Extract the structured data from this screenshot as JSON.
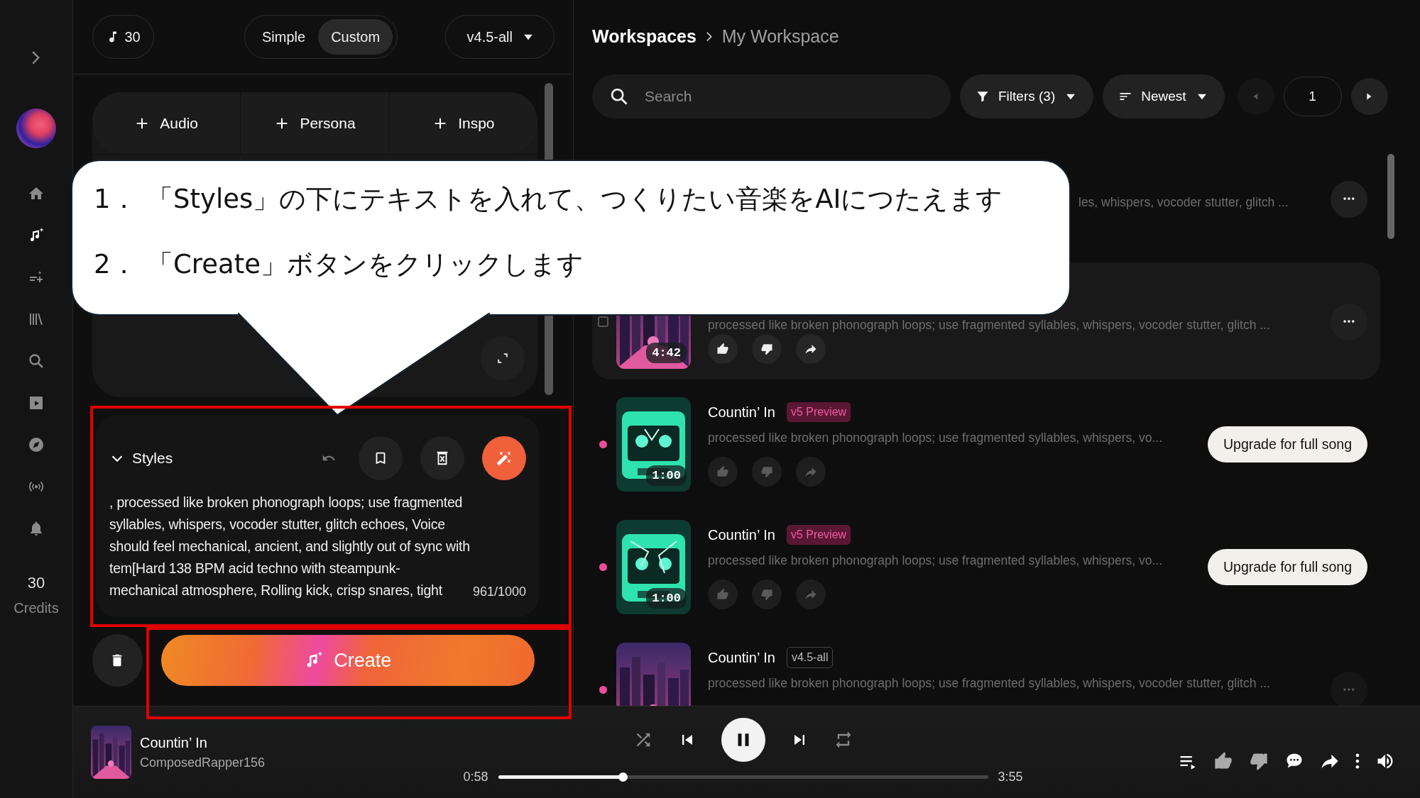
{
  "sidebar": {
    "nav": [
      {
        "kind": "home",
        "selected": false
      },
      {
        "kind": "create",
        "selected": true
      },
      {
        "kind": "playlist_add",
        "selected": false
      },
      {
        "kind": "library",
        "selected": false
      },
      {
        "kind": "search",
        "selected": false
      },
      {
        "kind": "video",
        "selected": false
      },
      {
        "kind": "explore",
        "selected": false
      },
      {
        "kind": "radio",
        "selected": false
      },
      {
        "kind": "notifications",
        "selected": false
      }
    ],
    "credits": {
      "count": "30",
      "label": "Credits"
    }
  },
  "create_panel": {
    "credits_pill": "30",
    "modes": [
      {
        "label": "Simple",
        "selected": false
      },
      {
        "label": "Custom",
        "selected": true
      }
    ],
    "model": "v4.5-all",
    "add_buttons": [
      "Audio",
      "Persona",
      "Inspo"
    ],
    "styles": {
      "title": "Styles",
      "expanded": true,
      "lines": [
        ", processed like broken phonograph loops; use fragmented",
        "syllables, whispers, vocoder stutter, glitch echoes, Voice",
        "should feel mechanical, ancient, and slightly out of sync with",
        "tem[Hard 138 BPM acid techno with steampunk-",
        "mechanical atmosphere, Rolling kick, crisp snares, tight"
      ],
      "counter": "961/1000",
      "highlighted": true
    },
    "create_button": {
      "label": "Create",
      "highlighted": true
    }
  },
  "workspace": {
    "breadcrumb": [
      {
        "label": "Workspaces",
        "current": false
      },
      {
        "label": "My Workspace",
        "current": true
      }
    ],
    "search": {
      "placeholder": "Search"
    },
    "filters": "Filters (3)",
    "sort": "Newest",
    "page": "1",
    "songs": [
      {
        "kind": "covered",
        "description": "les, whispers, vocoder stutter, glitch ..."
      },
      {
        "kind": "full",
        "duration": "4:42",
        "description": "processed like broken phonograph loops; use fragmented syllables, whispers, vocoder stutter, glitch ...",
        "new": false,
        "hovered": true
      },
      {
        "kind": "full",
        "title": "Countin’ In",
        "badge": {
          "label": "v5 Preview",
          "kind": "preview"
        },
        "duration": "1:00",
        "description": "processed like broken phonograph loops; use fragmented syllables, whispers, vo...",
        "new": true,
        "hovered": false,
        "action": "Upgrade for full song"
      },
      {
        "kind": "full",
        "title": "Countin’ In",
        "badge": {
          "label": "v5 Preview",
          "kind": "preview"
        },
        "duration": "1:00",
        "description": "processed like broken phonograph loops; use fragmented syllables, whispers, vo...",
        "new": true,
        "hovered": false,
        "action": "Upgrade for full song"
      },
      {
        "kind": "full",
        "title": "Countin’ In",
        "badge": {
          "label": "v4.5-all",
          "kind": "model"
        },
        "description": "processed like broken phonograph loops; use fragmented syllables, whispers, vocoder stutter, glitch ...",
        "new": true,
        "hovered": false
      }
    ]
  },
  "player": {
    "title": "Countin’ In",
    "artist": "ComposedRapper156",
    "playing": true,
    "elapsed": "0:58",
    "total": "3:55",
    "level": 0.255
  },
  "callout": {
    "steps": [
      {
        "number": "1．",
        "text": "「Styles」の下にテキストを入れて、つくりたい音楽をAIにつたえます"
      },
      {
        "number": "2．",
        "text": "「Create」ボタンをクリックします"
      }
    ]
  }
}
